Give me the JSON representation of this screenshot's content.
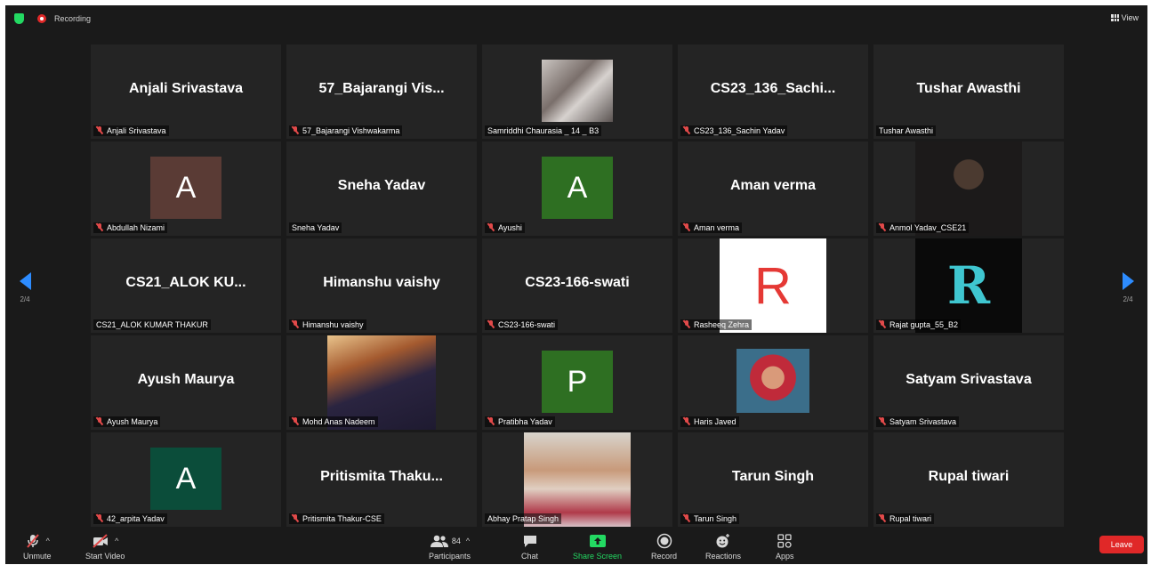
{
  "top_bar": {
    "recording_label": "Recording",
    "view_label": "View"
  },
  "pagination": {
    "left": "2/4",
    "right": "2/4"
  },
  "tiles": [
    {
      "big_name": "Anjali Srivastava",
      "label": "Anjali Srivastava",
      "muted": true,
      "kind": "name"
    },
    {
      "big_name": "57_Bajarangi Vis...",
      "label": "57_Bajarangi Vishwakarma",
      "muted": true,
      "kind": "name"
    },
    {
      "big_name": "",
      "label": "Samriddhi Chaurasia _ 14 _ B3",
      "muted": false,
      "kind": "photo"
    },
    {
      "big_name": "CS23_136_Sachi...",
      "label": "CS23_136_Sachin Yadav",
      "muted": true,
      "kind": "name"
    },
    {
      "big_name": "Tushar Awasthi",
      "label": "Tushar Awasthi",
      "muted": false,
      "kind": "name"
    },
    {
      "big_name": "A",
      "label": "Abdullah Nizami",
      "muted": true,
      "kind": "avatar",
      "avatar_color": "#5a3b35"
    },
    {
      "big_name": "Sneha Yadav",
      "label": "Sneha Yadav",
      "muted": false,
      "kind": "name"
    },
    {
      "big_name": "A",
      "label": "Ayushi",
      "muted": true,
      "kind": "avatar",
      "avatar_color": "#2e6f22"
    },
    {
      "big_name": "Aman verma",
      "label": "Aman verma",
      "muted": true,
      "kind": "name"
    },
    {
      "big_name": "",
      "label": "Anmol Yadav_CSE21",
      "muted": true,
      "kind": "photo"
    },
    {
      "big_name": "CS21_ALOK KU...",
      "label": "CS21_ALOK KUMAR THAKUR",
      "muted": false,
      "kind": "name"
    },
    {
      "big_name": "Himanshu vaishy",
      "label": "Himanshu vaishy",
      "muted": true,
      "kind": "name"
    },
    {
      "big_name": "CS23-166-swati",
      "label": "CS23-166-swati",
      "muted": true,
      "kind": "name"
    },
    {
      "big_name": "R",
      "label": "Rasheeq Zehra",
      "muted": true,
      "kind": "letter-image",
      "avatar_color": "#e53935"
    },
    {
      "big_name": "R",
      "label": "Rajat gupta_55_B2",
      "muted": true,
      "kind": "letter-image",
      "avatar_color": "#3fc6d0"
    },
    {
      "big_name": "Ayush Maurya",
      "label": "Ayush Maurya",
      "muted": true,
      "kind": "name"
    },
    {
      "big_name": "",
      "label": "Mohd Anas Nadeem",
      "muted": true,
      "kind": "photo"
    },
    {
      "big_name": "P",
      "label": "Pratibha Yadav",
      "muted": true,
      "kind": "avatar",
      "avatar_color": "#2e6f22"
    },
    {
      "big_name": "",
      "label": "Haris Javed",
      "muted": true,
      "kind": "photo"
    },
    {
      "big_name": "Satyam Srivastava",
      "label": "Satyam Srivastava",
      "muted": true,
      "kind": "name"
    },
    {
      "big_name": "A",
      "label": "42_arpita Yadav",
      "muted": true,
      "kind": "avatar",
      "avatar_color": "#0b4d3a"
    },
    {
      "big_name": "Pritismita  Thaku...",
      "label": "Pritismita Thakur-CSE",
      "muted": true,
      "kind": "name"
    },
    {
      "big_name": "",
      "label": "Abhay Pratap Singh",
      "muted": false,
      "kind": "photo"
    },
    {
      "big_name": "Tarun Singh",
      "label": "Tarun Singh",
      "muted": true,
      "kind": "name"
    },
    {
      "big_name": "Rupal tiwari",
      "label": "Rupal tiwari",
      "muted": true,
      "kind": "name"
    }
  ],
  "toolbar": {
    "unmute": "Unmute",
    "start_video": "Start Video",
    "participants": "Participants",
    "participants_count": "84",
    "chat": "Chat",
    "share_screen": "Share Screen",
    "record": "Record",
    "reactions": "Reactions",
    "apps": "Apps",
    "leave": "Leave"
  },
  "colors": {
    "background": "#1a1a1a",
    "tile": "#242424",
    "accent_blue": "#2d8cff",
    "share_green": "#23d962",
    "leave_red": "#e02828",
    "mute_red": "#e24a4a"
  }
}
